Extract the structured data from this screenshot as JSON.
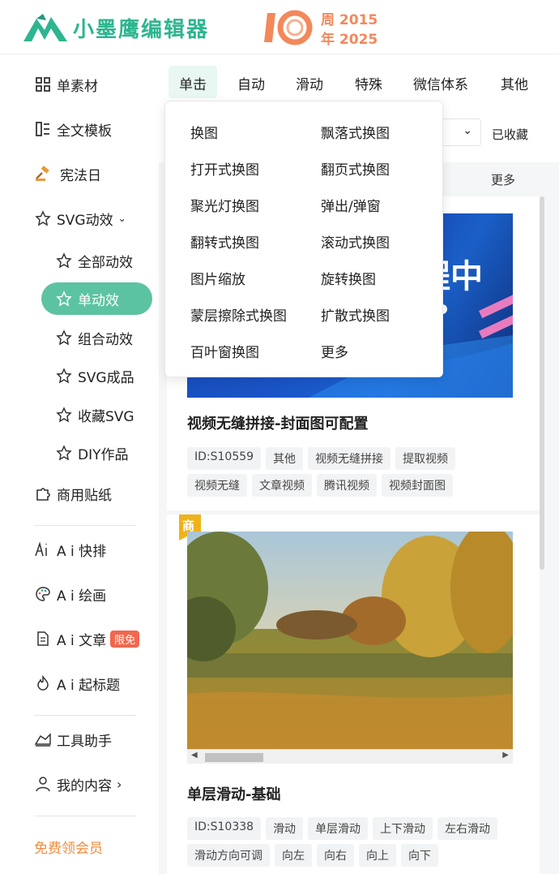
{
  "header": {
    "app_title": "小墨鹰编辑器",
    "anniversary_num": "10",
    "anniversary_line1": "周 2015",
    "anniversary_line2": "年 2025"
  },
  "sidebar": {
    "items": [
      {
        "label": "单素材",
        "icon": "grid-icon"
      },
      {
        "label": "全文模板",
        "icon": "template-icon"
      },
      {
        "label": "宪法日",
        "icon": "gavel-icon"
      },
      {
        "label": "SVG动效",
        "icon": "star-svg-icon"
      },
      {
        "label": "全部动效",
        "icon": "star-s-icon"
      },
      {
        "label": "单动效",
        "icon": "star-1-icon"
      },
      {
        "label": "组合动效",
        "icon": "star-n-icon"
      },
      {
        "label": "SVG成品",
        "icon": "star-outline-icon"
      },
      {
        "label": "收藏SVG",
        "icon": "star-outline-icon"
      },
      {
        "label": "DIY作品",
        "icon": "star-diy-icon"
      },
      {
        "label": "商用贴纸",
        "icon": "puzzle-icon"
      },
      {
        "label": "A i 快排",
        "icon": "ai-icon"
      },
      {
        "label": "A i 绘画",
        "icon": "palette-icon"
      },
      {
        "label": "A i 文章",
        "icon": "doc-icon"
      },
      {
        "label": "A i 起标题",
        "icon": "flame-icon"
      },
      {
        "label": "工具助手",
        "icon": "tools-icon"
      },
      {
        "label": "我的内容",
        "icon": "user-icon"
      }
    ],
    "ai_article_badge": "限免",
    "free_vip": "免费领会员"
  },
  "tabs": [
    "单击",
    "自动",
    "滑动",
    "特殊",
    "微信体系",
    "其他"
  ],
  "toolbar": {
    "select_value": "",
    "fav_label": "已收藏"
  },
  "more_label": "更多",
  "dropdown": {
    "left": [
      "换图",
      "打开式换图",
      "聚光灯换图",
      "翻转式换图",
      "图片缩放",
      "蒙层擦除式换图",
      "百叶窗换图"
    ],
    "right": [
      "飘落式换图",
      "翻页式换图",
      "弹出/弹窗",
      "滚动式换图",
      "旋转换图",
      "扩散式换图",
      "更多"
    ]
  },
  "cards": [
    {
      "title": "视频无缝拼接-封面图可配置",
      "banner_text": "程中",
      "tags_row1": [
        "ID:S10559",
        "其他",
        "视频无缝拼接",
        "提取视频"
      ],
      "tags_row2": [
        "视频无缝",
        "文章视频",
        "腾讯视频",
        "视频封面图"
      ]
    },
    {
      "title": "单层滑动-基础",
      "corner_badge": "商",
      "tags_row1": [
        "ID:S10338",
        "滑动",
        "单层滑动",
        "上下滑动",
        "左右滑动"
      ],
      "tags_row2": [
        "滑动方向可调",
        "向左",
        "向右",
        "向上",
        "向下"
      ]
    }
  ],
  "colors": {
    "brand": "#2db58f",
    "accent": "#f3885b",
    "active": "#5cc3a2",
    "badge": "#f2674d"
  }
}
